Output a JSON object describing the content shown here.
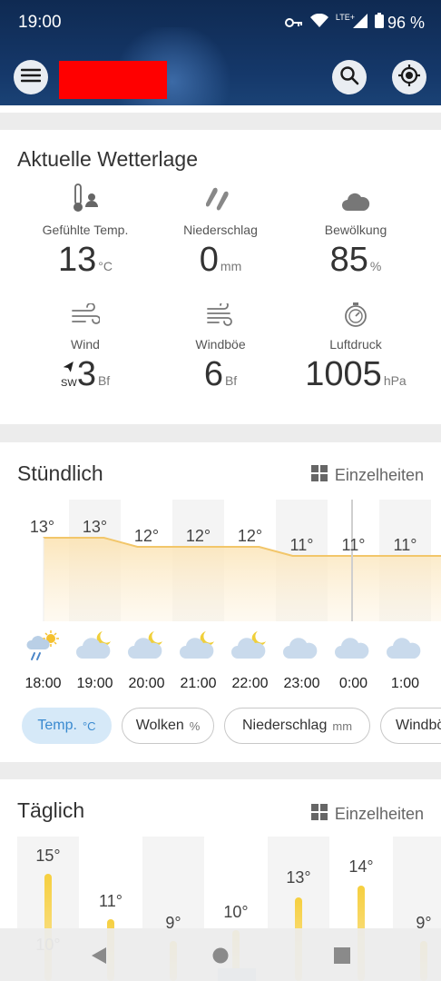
{
  "status": {
    "time": "19:00",
    "network": "LTE+",
    "battery": "96 %"
  },
  "appbar": {
    "menu_icon": "menu-icon",
    "search_icon": "search-icon",
    "location_icon": "locate-icon"
  },
  "current": {
    "title": "Aktuelle Wetterlage",
    "items": [
      {
        "label": "Gefühlte Temp.",
        "value": "13",
        "unit": "°C",
        "icon": "thermometer-person-icon"
      },
      {
        "label": "Niederschlag",
        "value": "0",
        "unit": "mm",
        "icon": "rain-icon"
      },
      {
        "label": "Bewölkung",
        "value": "85",
        "unit": "%",
        "icon": "cloud-icon"
      },
      {
        "label": "Wind",
        "value": "3",
        "unit": "Bf",
        "direction": "SW",
        "icon": "wind-icon"
      },
      {
        "label": "Windböe",
        "value": "6",
        "unit": "Bf",
        "icon": "gust-icon"
      },
      {
        "label": "Luftdruck",
        "value": "1005",
        "unit": "hPa",
        "icon": "barometer-icon"
      }
    ]
  },
  "hourly": {
    "title": "Stündlich",
    "details_label": "Einzelheiten",
    "temps": [
      "13°",
      "13°",
      "12°",
      "12°",
      "12°",
      "11°",
      "11°",
      "11°"
    ],
    "temp_values": [
      13,
      13,
      12,
      12,
      12,
      11,
      11,
      11
    ],
    "times": [
      "18:00",
      "19:00",
      "20:00",
      "21:00",
      "22:00",
      "23:00",
      "0:00",
      "1:00"
    ],
    "icons": [
      "sun-cloud-rain-icon",
      "cloud-moon-icon",
      "cloud-moon-icon",
      "cloud-moon-icon",
      "cloud-moon-icon",
      "cloud-icon",
      "cloud-icon",
      "cloud-icon"
    ],
    "chips": [
      {
        "label": "Temp.",
        "unit": "°C"
      },
      {
        "label": "Wolken",
        "unit": "%"
      },
      {
        "label": "Niederschlag",
        "unit": "mm"
      },
      {
        "label": "Windbö",
        "unit": ""
      }
    ]
  },
  "daily": {
    "title": "Täglich",
    "details_label": "Einzelheiten",
    "max_temps": [
      "15°",
      "11°",
      "9°",
      "10°",
      "13°",
      "14°",
      "9°"
    ],
    "min_temps": [
      "10°"
    ]
  },
  "colors": {
    "accent": "#3a8ad0",
    "chart_fill": "#fbe9c1",
    "chart_line": "#f2c66a",
    "bar": "#f6cf3f"
  }
}
